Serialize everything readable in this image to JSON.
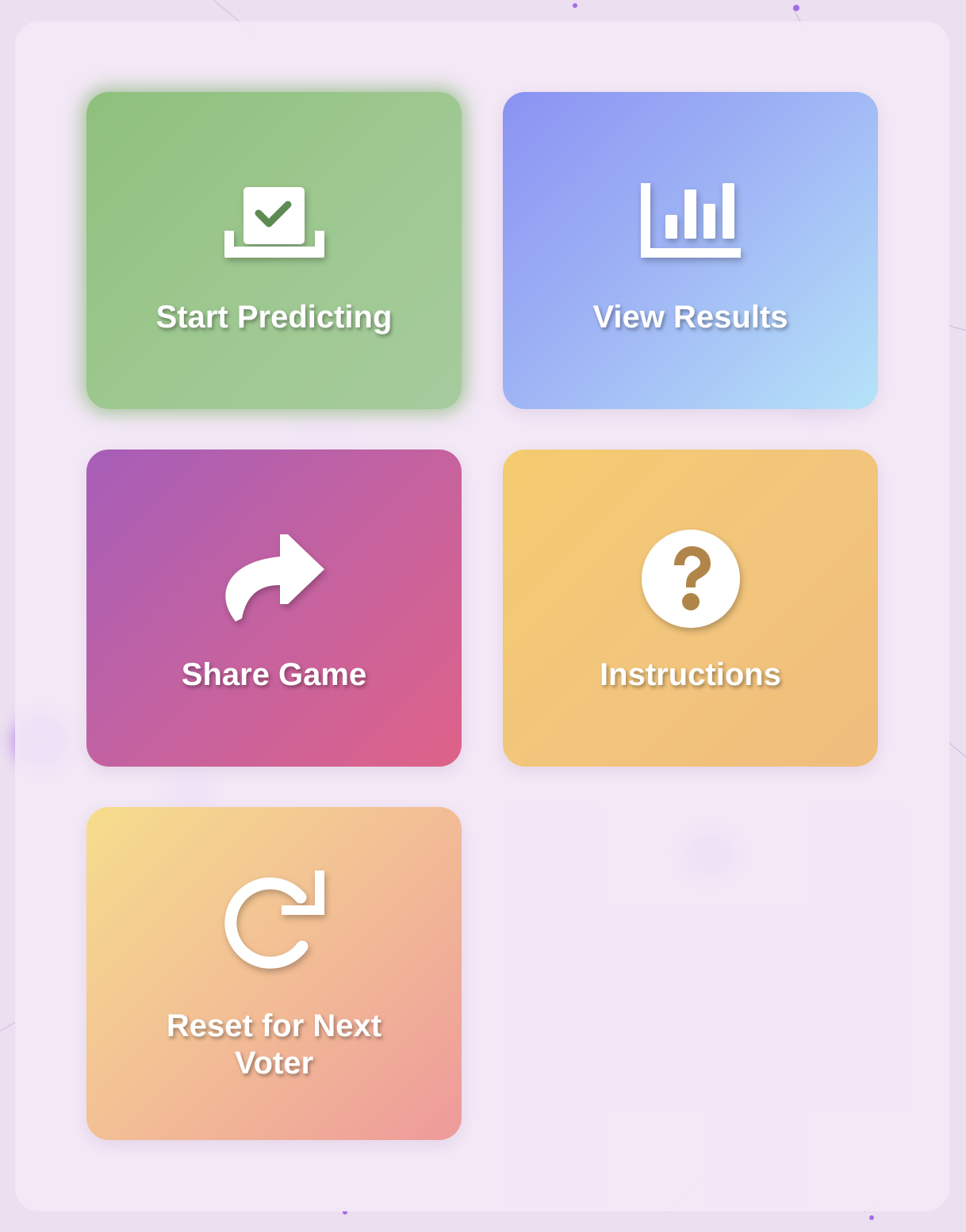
{
  "menu": {
    "tiles": [
      {
        "id": "start",
        "label": "Start Predicting",
        "icon": "ballot-box-check-icon",
        "color": "#9ec891"
      },
      {
        "id": "results",
        "label": "View Results",
        "icon": "bar-chart-icon",
        "color": "#a0b7f5"
      },
      {
        "id": "share",
        "label": "Share Game",
        "icon": "share-arrow-icon",
        "color": "#c462a0"
      },
      {
        "id": "instructions",
        "label": "Instructions",
        "icon": "question-circle-icon",
        "color": "#f2c57c"
      },
      {
        "id": "reset",
        "label": "Reset for Next Voter",
        "icon": "redo-arrow-icon",
        "color": "#f2be95"
      }
    ]
  },
  "theme": {
    "background": "#ecdff0",
    "panel": "#f3e8f6",
    "accent_blob": "#a46de6"
  }
}
